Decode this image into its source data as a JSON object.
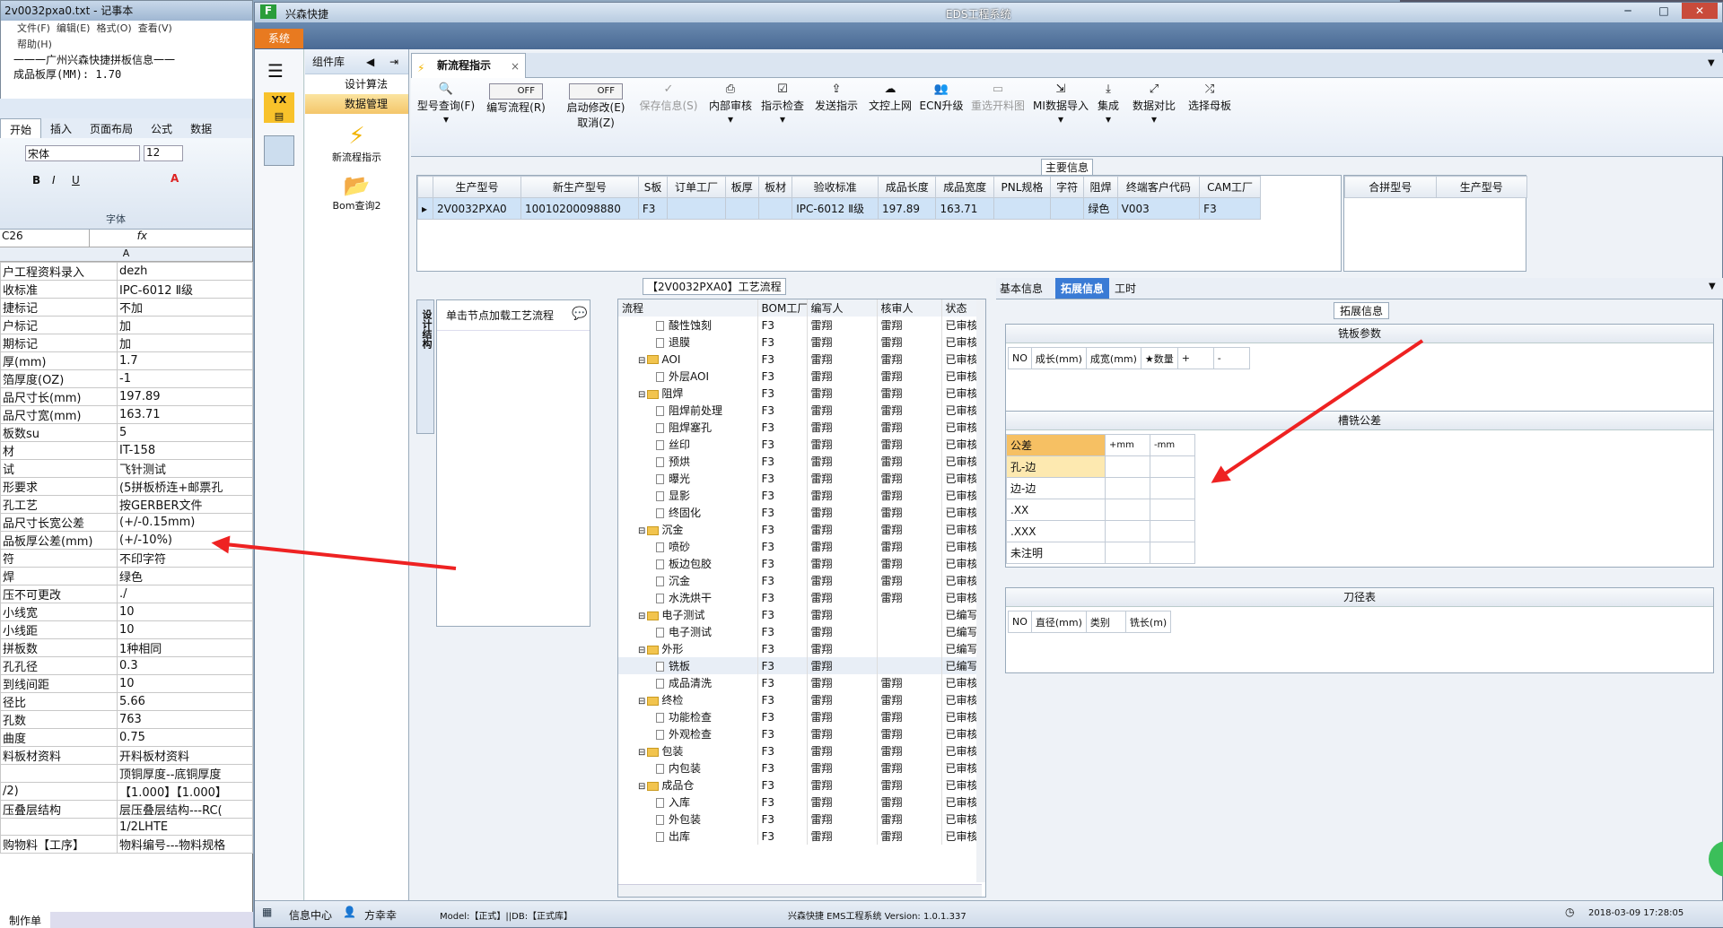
{
  "notepad": {
    "title": "2v0032pxa0.txt - 记事本",
    "menu": [
      "文件(F)",
      "编辑(E)",
      "格式(O)",
      "查看(V)",
      "帮助(H)"
    ],
    "lines": [
      "一一一广州兴森快捷拼板信息一一",
      "成品板厚(MM): 1.70"
    ]
  },
  "excel": {
    "tabs": [
      "开始",
      "插入",
      "页面布局",
      "公式",
      "数据"
    ],
    "font_name": "宋体",
    "font_size": "12",
    "group_label": "字体",
    "cell_ref": "C26",
    "fx": "fx",
    "col_header": "A",
    "rows": [
      [
        "户工程资料录入",
        "dezh"
      ],
      [
        "收标准",
        "IPC-6012 Ⅱ级"
      ],
      [
        "捷标记",
        "不加"
      ],
      [
        "户标记",
        "加"
      ],
      [
        "期标记",
        "加"
      ],
      [
        "厚(mm)",
        "1.7"
      ],
      [
        "箔厚度(OZ)",
        "-1"
      ],
      [
        "品尺寸长(mm)",
        "197.89"
      ],
      [
        "品尺寸宽(mm)",
        "163.71"
      ],
      [
        "板数su",
        "5"
      ],
      [
        "材",
        "IT-158"
      ],
      [
        "试",
        "飞针测试"
      ],
      [
        "形要求",
        "(5拼板桥连+邮票孔"
      ],
      [
        "孔工艺",
        "按GERBER文件"
      ],
      [
        "品尺寸长宽公差",
        "(+/-0.15mm)"
      ],
      [
        "品板厚公差(mm)",
        "(+/-10%)"
      ],
      [
        "符",
        "不印字符"
      ],
      [
        "焊",
        "绿色"
      ],
      [
        "压不可更改",
        "./"
      ],
      [
        "小线宽",
        "10"
      ],
      [
        "小线距",
        "10"
      ],
      [
        "拼板数",
        "1种相同"
      ],
      [
        "孔孔径",
        "0.3"
      ],
      [
        "到线间距",
        "10"
      ],
      [
        "径比",
        "5.66"
      ],
      [
        "孔数",
        "763"
      ],
      [
        "曲度",
        "0.75"
      ],
      [
        "料板材资料",
        "开料板材资料"
      ],
      [
        "",
        "顶铜厚度--底铜厚度"
      ],
      [
        "/2)",
        "【1.000】【1.000】"
      ],
      [
        "压叠层结构",
        "层压叠层结构---RC("
      ],
      [
        "",
        "1/2LHTE"
      ],
      [
        "购物料【工序】",
        "物料编号---物料规格"
      ]
    ],
    "sheet_tab": "制作单"
  },
  "app": {
    "name": "兴森快捷",
    "window_title": "EDS工程系统",
    "system_btn": "系统",
    "library_title": "组件库",
    "library_items": [
      "设计算法",
      "数据管理"
    ],
    "library_tools": [
      "新流程指示",
      "Bom查询2"
    ],
    "doc_tab": "新流程指示",
    "toolbar": {
      "query": "型号查询(F)",
      "toggle_off": "OFF",
      "write_flow": "编写流程(R)",
      "auto_modify": "启动修改(E)",
      "cancel": "取消(Z)",
      "save": "保存信息(S)",
      "buttons": [
        "内部审核",
        "指示检查",
        "发送指示",
        "文控上网",
        "ECN升级",
        "重选开料图",
        "MI数据导入",
        "集成",
        "数据对比",
        "选择母板"
      ]
    },
    "main_info": {
      "label": "主要信息",
      "headers": [
        "生产型号",
        "新生产型号",
        "S板",
        "订单工厂",
        "板厚",
        "板材",
        "验收标准",
        "成品长度",
        "成品宽度",
        "PNL规格",
        "字符",
        "阻焊",
        "终端客户代码",
        "CAM工厂"
      ],
      "row": [
        "2V0032PXA0",
        "10010200098880",
        "F3",
        "",
        "",
        "",
        "IPC-6012 Ⅱ级",
        "197.89",
        "163.71",
        "",
        "",
        "绿色",
        "V003",
        "F3"
      ],
      "side_headers": [
        "合拼型号",
        "生产型号"
      ]
    },
    "flow": {
      "title": "【2V0032PXA0】工艺流程",
      "side_tab": "设计结构",
      "hint": "单击节点加载工艺流程",
      "headers": [
        "流程",
        "BOM工厂",
        "编写人",
        "核审人",
        "状态"
      ],
      "rows": [
        {
          "lv": 2,
          "type": "doc",
          "name": "酸性蚀刻",
          "bom": "F3",
          "w": "雷翔",
          "r": "雷翔",
          "s": "已审核"
        },
        {
          "lv": 2,
          "type": "doc",
          "name": "退膜",
          "bom": "F3",
          "w": "雷翔",
          "r": "雷翔",
          "s": "已审核"
        },
        {
          "lv": 1,
          "type": "folder",
          "name": "AOI",
          "bom": "F3",
          "w": "雷翔",
          "r": "雷翔",
          "s": "已审核"
        },
        {
          "lv": 2,
          "type": "doc",
          "name": "外层AOI",
          "bom": "F3",
          "w": "雷翔",
          "r": "雷翔",
          "s": "已审核"
        },
        {
          "lv": 1,
          "type": "folder",
          "name": "阻焊",
          "bom": "F3",
          "w": "雷翔",
          "r": "雷翔",
          "s": "已审核"
        },
        {
          "lv": 2,
          "type": "doc",
          "name": "阻焊前处理",
          "bom": "F3",
          "w": "雷翔",
          "r": "雷翔",
          "s": "已审核"
        },
        {
          "lv": 2,
          "type": "doc",
          "name": "阻焊塞孔",
          "bom": "F3",
          "w": "雷翔",
          "r": "雷翔",
          "s": "已审核"
        },
        {
          "lv": 2,
          "type": "doc",
          "name": "丝印",
          "bom": "F3",
          "w": "雷翔",
          "r": "雷翔",
          "s": "已审核"
        },
        {
          "lv": 2,
          "type": "doc",
          "name": "预烘",
          "bom": "F3",
          "w": "雷翔",
          "r": "雷翔",
          "s": "已审核"
        },
        {
          "lv": 2,
          "type": "doc",
          "name": "曝光",
          "bom": "F3",
          "w": "雷翔",
          "r": "雷翔",
          "s": "已审核"
        },
        {
          "lv": 2,
          "type": "doc",
          "name": "显影",
          "bom": "F3",
          "w": "雷翔",
          "r": "雷翔",
          "s": "已审核"
        },
        {
          "lv": 2,
          "type": "doc",
          "name": "终固化",
          "bom": "F3",
          "w": "雷翔",
          "r": "雷翔",
          "s": "已审核"
        },
        {
          "lv": 1,
          "type": "folder",
          "name": "沉金",
          "bom": "F3",
          "w": "雷翔",
          "r": "雷翔",
          "s": "已审核"
        },
        {
          "lv": 2,
          "type": "doc",
          "name": "喷砂",
          "bom": "F3",
          "w": "雷翔",
          "r": "雷翔",
          "s": "已审核"
        },
        {
          "lv": 2,
          "type": "doc",
          "name": "板边包胶",
          "bom": "F3",
          "w": "雷翔",
          "r": "雷翔",
          "s": "已审核"
        },
        {
          "lv": 2,
          "type": "doc",
          "name": "沉金",
          "bom": "F3",
          "w": "雷翔",
          "r": "雷翔",
          "s": "已审核"
        },
        {
          "lv": 2,
          "type": "doc",
          "name": "水洗烘干",
          "bom": "F3",
          "w": "雷翔",
          "r": "雷翔",
          "s": "已审核"
        },
        {
          "lv": 1,
          "type": "folder",
          "name": "电子测试",
          "bom": "F3",
          "w": "雷翔",
          "r": "",
          "s": "已编写"
        },
        {
          "lv": 2,
          "type": "doc",
          "name": "电子测试",
          "bom": "F3",
          "w": "雷翔",
          "r": "",
          "s": "已编写"
        },
        {
          "lv": 1,
          "type": "folder",
          "name": "外形",
          "bom": "F3",
          "w": "雷翔",
          "r": "",
          "s": "已编写"
        },
        {
          "lv": 2,
          "type": "doc",
          "name": "铣板",
          "bom": "F3",
          "w": "雷翔",
          "r": "",
          "s": "已编写"
        },
        {
          "lv": 2,
          "type": "doc",
          "name": "成品清洗",
          "bom": "F3",
          "w": "雷翔",
          "r": "雷翔",
          "s": "已审核"
        },
        {
          "lv": 1,
          "type": "folder",
          "name": "终检",
          "bom": "F3",
          "w": "雷翔",
          "r": "雷翔",
          "s": "已审核"
        },
        {
          "lv": 2,
          "type": "doc",
          "name": "功能检查",
          "bom": "F3",
          "w": "雷翔",
          "r": "雷翔",
          "s": "已审核"
        },
        {
          "lv": 2,
          "type": "doc",
          "name": "外观检查",
          "bom": "F3",
          "w": "雷翔",
          "r": "雷翔",
          "s": "已审核"
        },
        {
          "lv": 1,
          "type": "folder",
          "name": "包装",
          "bom": "F3",
          "w": "雷翔",
          "r": "雷翔",
          "s": "已审核"
        },
        {
          "lv": 2,
          "type": "doc",
          "name": "内包装",
          "bom": "F3",
          "w": "雷翔",
          "r": "雷翔",
          "s": "已审核"
        },
        {
          "lv": 1,
          "type": "folder",
          "name": "成品仓",
          "bom": "F3",
          "w": "雷翔",
          "r": "雷翔",
          "s": "已审核"
        },
        {
          "lv": 2,
          "type": "doc",
          "name": "入库",
          "bom": "F3",
          "w": "雷翔",
          "r": "雷翔",
          "s": "已审核"
        },
        {
          "lv": 2,
          "type": "doc",
          "name": "外包装",
          "bom": "F3",
          "w": "雷翔",
          "r": "雷翔",
          "s": "已审核"
        },
        {
          "lv": 2,
          "type": "doc",
          "name": "出库",
          "bom": "F3",
          "w": "雷翔",
          "r": "雷翔",
          "s": "已审核"
        }
      ]
    },
    "info_tabs": [
      "基本信息",
      "拓展信息",
      "工时"
    ],
    "ext": {
      "label": "拓展信息",
      "mill_params": "铣板参数",
      "mill_headers": [
        "NO",
        "成长(mm)",
        "成宽(mm)",
        "★数量",
        "+",
        "-"
      ],
      "slot_tol": "槽铣公差",
      "tol_headers": [
        "公差",
        "+mm",
        "-mm"
      ],
      "tol_rows": [
        "孔-边",
        "边-边",
        ".XX",
        ".XXX",
        "未注明"
      ],
      "cutter": "刀径表",
      "cutter_headers": [
        "NO",
        "直径(mm)",
        "类别",
        "铣长(m)"
      ]
    },
    "status": {
      "info_center": "信息中心",
      "user": "方幸幸",
      "model": "Model:【正式】||DB:【正式库】",
      "version": "兴森快捷 EMS工程系统 Version: 1.0.1.337",
      "datetime": "2018-03-09 17:28:05"
    }
  },
  "colors": {
    "arrow": "#ee2222",
    "selected_tab": "#3a7bd5",
    "tol_header": "#f6c063"
  }
}
